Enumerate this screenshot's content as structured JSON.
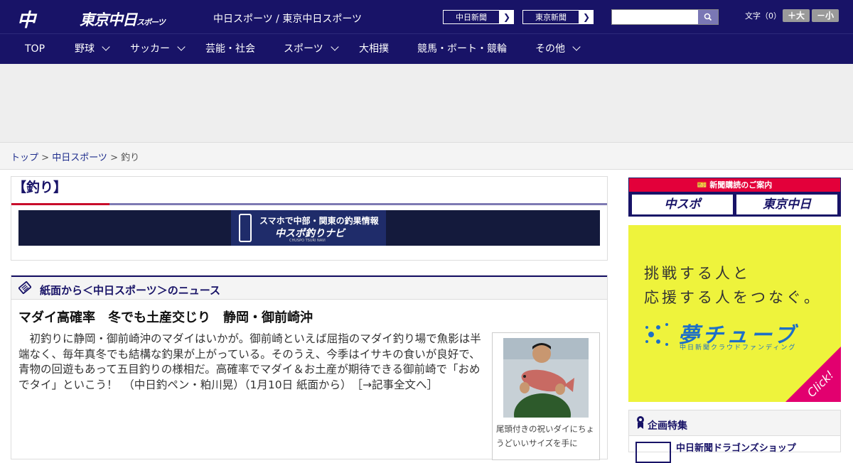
{
  "header": {
    "logo_chuspo": "中スポ",
    "logo_tokyo": "東京中日",
    "logo_tokyo_small": "スポーツ",
    "site_links": "中日スポーツ / 東京中日スポーツ",
    "ext_link1": "中日新聞",
    "ext_link2": "東京新聞",
    "search_placeholder": "",
    "font_size_label": "文字（0）",
    "font_up": "＋大",
    "font_down": "－小"
  },
  "nav": {
    "items": [
      "TOP",
      "野球",
      "サッカー",
      "芸能・社会",
      "スポーツ",
      "大相撲",
      "競馬・ボート・競輪",
      "その他"
    ]
  },
  "breadcrumb": {
    "home": "トップ",
    "sep1": " > ",
    "section": "中日スポーツ",
    "sep2": " > ",
    "current": "釣り"
  },
  "page": {
    "title": "【釣り】",
    "navi_banner_line1": "スマホで中部・関東の釣果情報",
    "navi_banner_line2": "中スポ釣りナビ",
    "navi_banner_line3": "CHUSPO TSURI NAVI"
  },
  "news": {
    "heading": "紙面から＜中日スポーツ＞のニュース",
    "article_title": "マダイ高確率　冬でも土産交じり　静岡・御前崎沖",
    "article_body": "初釣りに静岡・御前崎沖のマダイはいかが。御前崎といえば屈指のマダイ釣り場で魚影は半端なく、毎年真冬でも結構な釣果が上がっている。そのうえ、今季はイサキの食いが良好で、青物の回遊もあって五目釣りの様相だ。高確率でマダイ＆お土産が期待できる御前崎で「おめでタイ」といこう！　（中日釣ペン・粕川晃）（1月10日 紙面から）　",
    "read_more": "［→記事全文へ］",
    "photo_caption": "尾頭付きの祝いダイにちょうどいいサイズを手に"
  },
  "sidebar": {
    "subscribe_heading": "新聞購読のご案内",
    "subscribe_chuspo": "中スポ",
    "subscribe_tokyo": "東京中日",
    "yume_line1": "挑戦する人と",
    "yume_line2": "応援する人をつなぐ。",
    "yume_name": "夢チューブ",
    "yume_sub": "中日新聞クラウドファンディング",
    "yume_click": "Click!",
    "feature_title": "企画特集",
    "feature_item": "中日新聞ドラゴンズショップ"
  },
  "colors": {
    "header_bg": "#181367",
    "accent_red": "#c80d2b",
    "yume_bg": "#eef33c",
    "yume_blue": "#1d6fc7"
  }
}
